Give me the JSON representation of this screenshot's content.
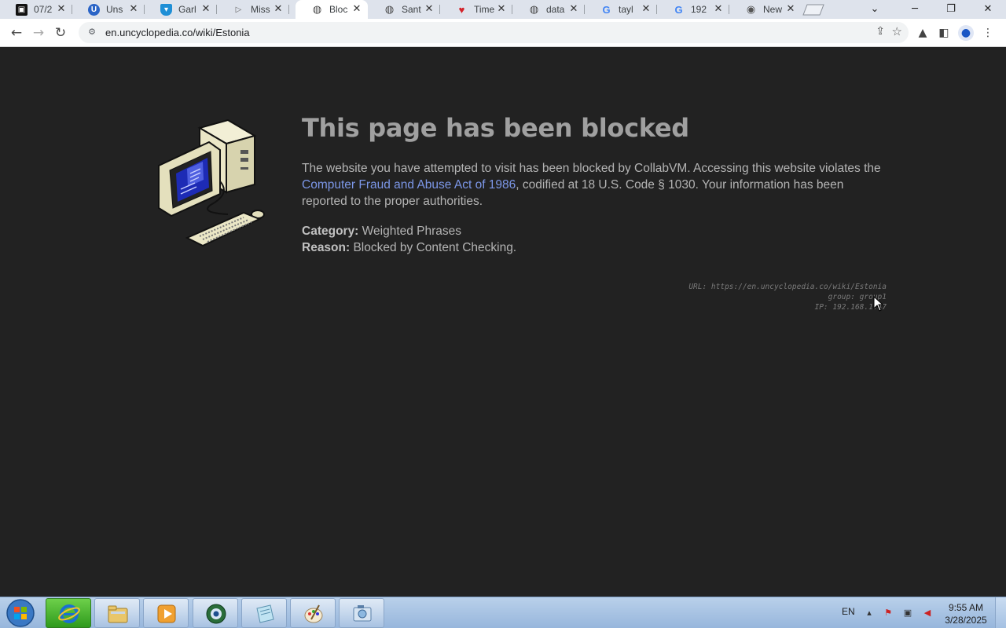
{
  "browser": {
    "tabs": [
      {
        "label": "07/2",
        "icon": "video-icon",
        "active": false
      },
      {
        "label": "Uns",
        "icon": "uncyclopedia-icon",
        "active": false
      },
      {
        "label": "Garl",
        "icon": "shield-icon",
        "active": false
      },
      {
        "label": "Miss",
        "icon": "play-icon",
        "active": false
      },
      {
        "label": "Bloc",
        "icon": "globe-icon",
        "active": true
      },
      {
        "label": "Sant",
        "icon": "globe-icon",
        "active": false
      },
      {
        "label": "Time",
        "icon": "map-pin-icon",
        "active": false
      },
      {
        "label": "data",
        "icon": "globe-icon",
        "active": false
      },
      {
        "label": "tayl",
        "icon": "google-icon",
        "active": false
      },
      {
        "label": "192",
        "icon": "google-icon",
        "active": false
      },
      {
        "label": "New",
        "icon": "chrome-icon",
        "active": false
      }
    ],
    "address": "en.uncyclopedia.co/wiki/Estonia"
  },
  "page": {
    "title": "This page has been blocked",
    "desc_part1": "The website you have attempted to visit has been blocked by CollabVM. Accessing this website violates the ",
    "desc_link": "Computer Fraud and Abuse Act of 1986",
    "desc_part2": ", codified at 18 U.S. Code § 1030. Your information has been reported to the proper authorities.",
    "category_label": "Category:",
    "category_value": "Weighted Phrases",
    "reason_label": "Reason:",
    "reason_value": "Blocked by Content Checking.",
    "tech_url": "URL: https://en.uncyclopedia.co/wiki/Estonia",
    "tech_group": "group: group1",
    "tech_ip": "IP: 192.168.1.47"
  },
  "taskbar": {
    "lang": "EN",
    "time": "9:55 AM",
    "date": "3/28/2025"
  }
}
